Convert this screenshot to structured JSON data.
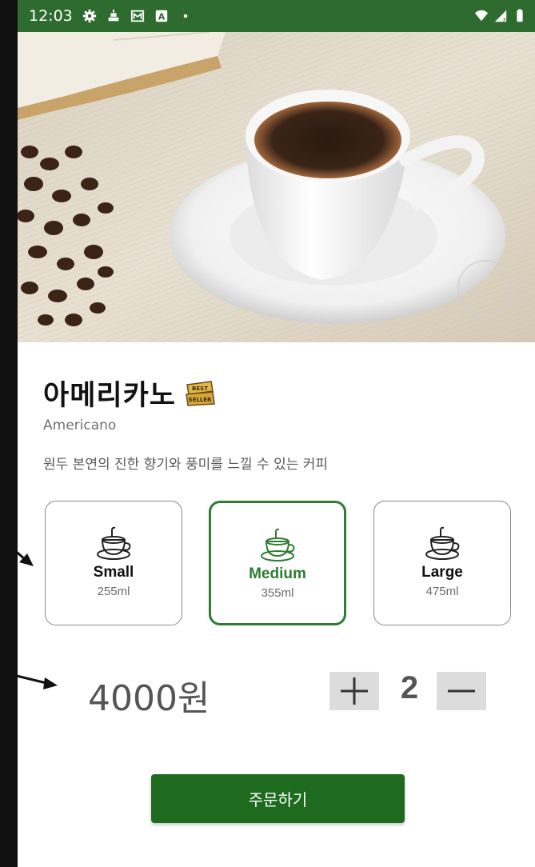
{
  "status_bar": {
    "time": "12:03",
    "left_icons": [
      "gear-icon",
      "notification-icon",
      "gmail-icon",
      "a-icon",
      "dot-icon"
    ],
    "right_icons": [
      "wifi-icon",
      "signal-icon",
      "battery-icon"
    ],
    "color": "#2e6b2f"
  },
  "product": {
    "name_ko": "아메리카노",
    "badge_lines": [
      "BEST",
      "SELLER"
    ],
    "name_en": "Americano",
    "description": "원두 본연의 진한 향기와 풍미를 느낄 수 있는 커피"
  },
  "sizes": [
    {
      "name": "Small",
      "volume": "255ml",
      "selected": false
    },
    {
      "name": "Medium",
      "volume": "355ml",
      "selected": true
    },
    {
      "name": "Large",
      "volume": "475ml",
      "selected": false
    }
  ],
  "order": {
    "price": "4000원",
    "quantity": "2",
    "plus_label": "+",
    "minus_label": "−",
    "button_label": "주문하기"
  },
  "colors": {
    "accent": "#2e7d32",
    "button": "#1e6b1f"
  }
}
